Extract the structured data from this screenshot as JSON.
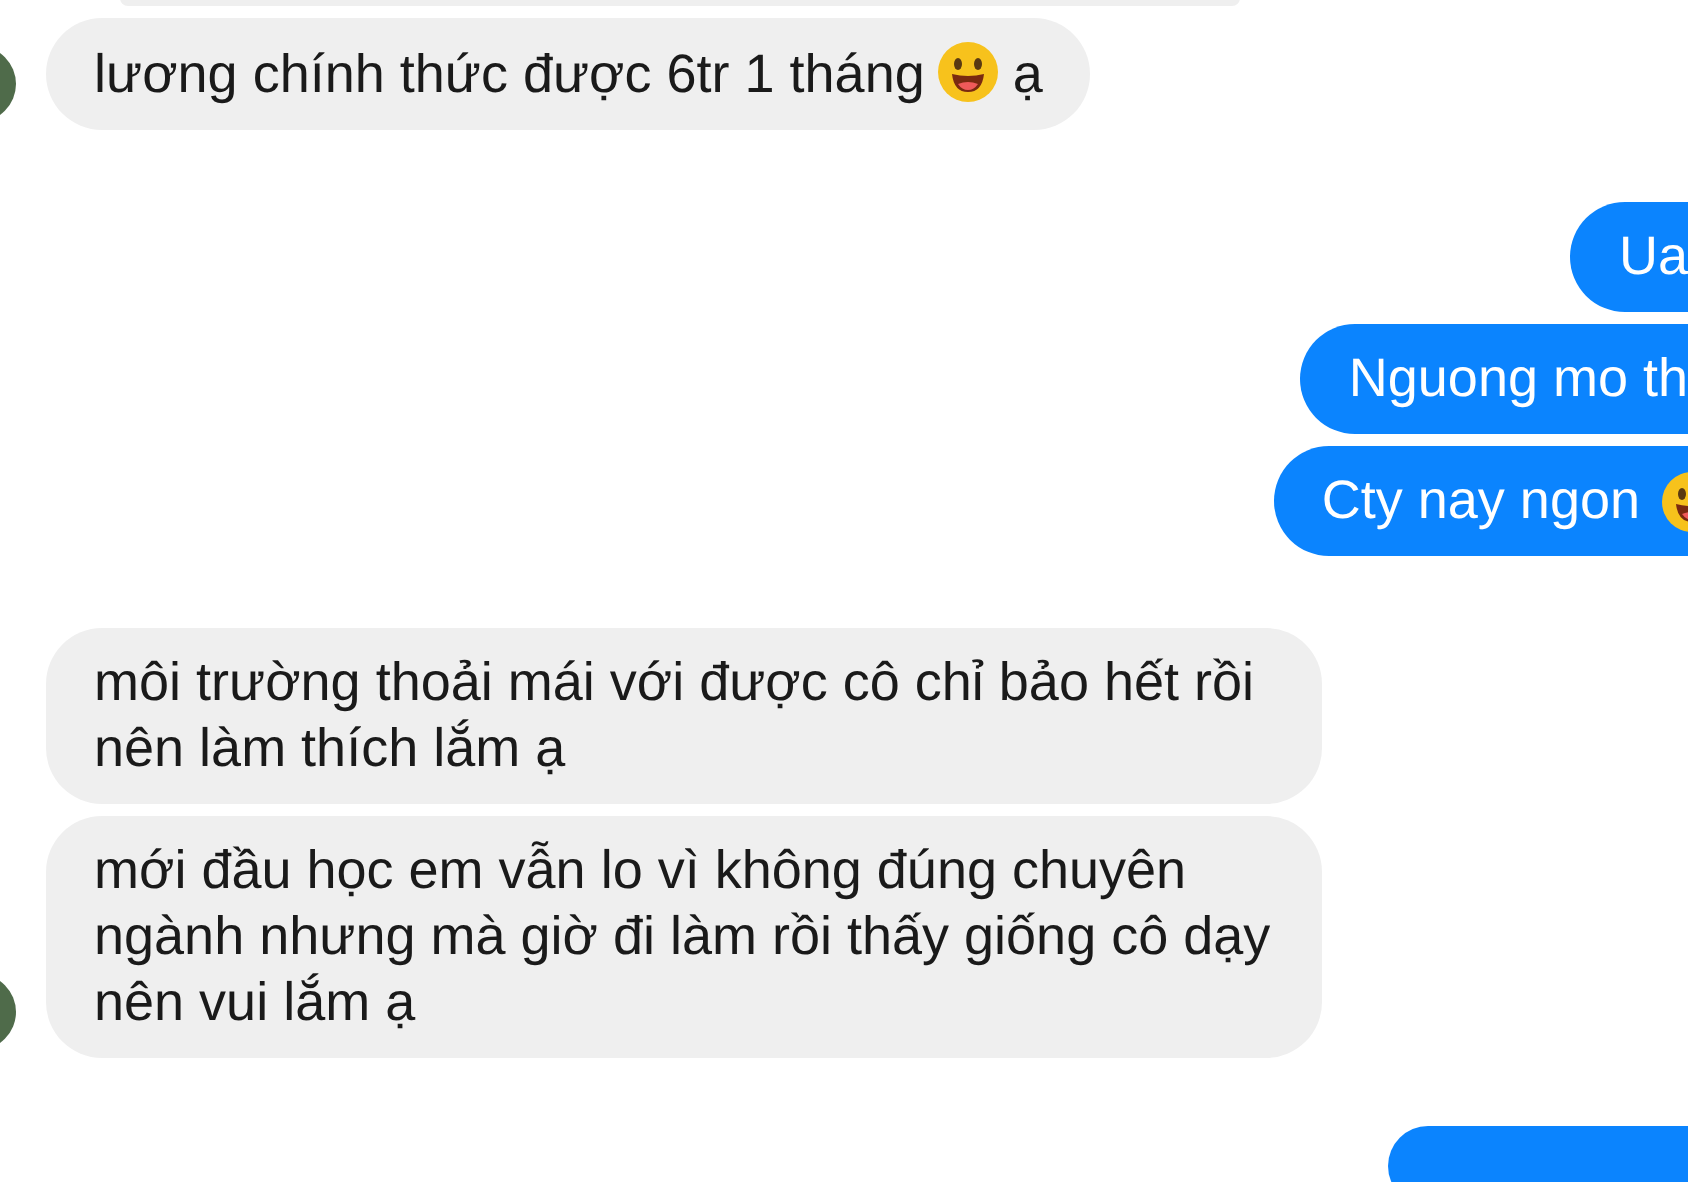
{
  "messages": [
    {
      "kind": "incoming",
      "avatar": true,
      "parts": [
        {
          "kind": "text",
          "text": "lương chính thức được 6tr 1 tháng"
        },
        {
          "kind": "emoji"
        },
        {
          "kind": "text",
          "text": "ạ"
        }
      ]
    },
    {
      "kind": "outgoing",
      "avatar": false,
      "parts": [
        {
          "kind": "text",
          "text": "Ua"
        }
      ]
    },
    {
      "kind": "outgoing",
      "avatar": false,
      "parts": [
        {
          "kind": "text",
          "text": "Nguong mo th"
        }
      ]
    },
    {
      "kind": "outgoing",
      "avatar": false,
      "parts": [
        {
          "kind": "text",
          "text": "Cty nay ngon"
        },
        {
          "kind": "emoji"
        }
      ]
    },
    {
      "kind": "incoming",
      "avatar": false,
      "parts": [
        {
          "kind": "text",
          "text": "môi trường thoải mái với được cô chỉ bảo hết rồi nên làm thích lắm ạ"
        }
      ]
    },
    {
      "kind": "incoming",
      "avatar": true,
      "parts": [
        {
          "kind": "text",
          "text": "mới đầu học em vẫn lo vì không đúng chuyên ngành nhưng mà giờ đi làm rồi thấy giống cô dạy nên vui lắm ạ"
        }
      ]
    },
    {
      "kind": "outgoing",
      "avatar": false
    }
  ]
}
